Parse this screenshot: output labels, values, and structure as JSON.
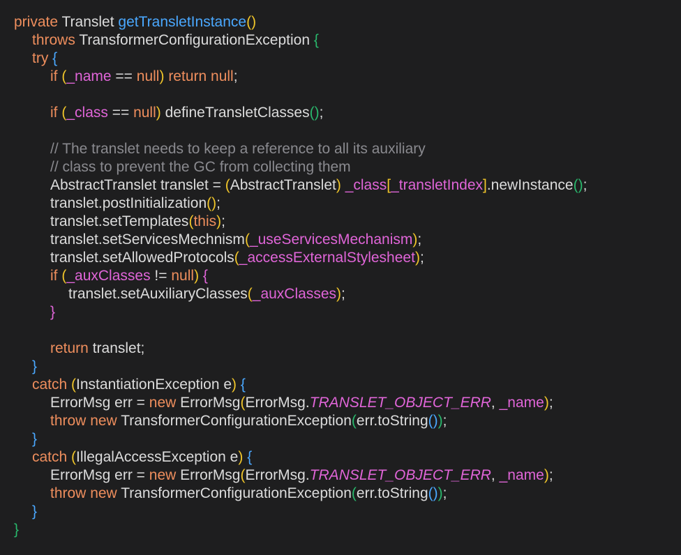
{
  "editor": {
    "theme": {
      "background": "#1e1e1f",
      "text": "#dcdcdc",
      "keyword": "#ee8e5d",
      "function": "#4aa8ff",
      "comment": "#8a8a8f",
      "field": "#e065d8",
      "bracket_yellow": "#f0c52a",
      "bracket_magenta": "#e065d8",
      "bracket_blue": "#4aa8ff",
      "bracket_green": "#29b86c"
    },
    "lines": [
      {
        "indent": 0,
        "tokens": [
          [
            "kw",
            "private"
          ],
          [
            "txt",
            " Translet "
          ],
          [
            "fn",
            "getTransletInstance"
          ],
          [
            "p1",
            "()"
          ]
        ]
      },
      {
        "indent": 1,
        "tokens": [
          [
            "kw",
            "throws"
          ],
          [
            "txt",
            " TransformerConfigurationException "
          ],
          [
            "p4",
            "{"
          ]
        ]
      },
      {
        "indent": 1,
        "tokens": [
          [
            "kw",
            "try"
          ],
          [
            "txt",
            " "
          ],
          [
            "p3",
            "{"
          ]
        ]
      },
      {
        "indent": 2,
        "tokens": [
          [
            "kw",
            "if"
          ],
          [
            "txt",
            " "
          ],
          [
            "p1",
            "("
          ],
          [
            "var",
            "_name"
          ],
          [
            "txt",
            " == "
          ],
          [
            "kw",
            "null"
          ],
          [
            "p1",
            ")"
          ],
          [
            "txt",
            " "
          ],
          [
            "kw",
            "return"
          ],
          [
            "txt",
            " "
          ],
          [
            "kw",
            "null"
          ],
          [
            "txt",
            ";"
          ]
        ]
      },
      {
        "indent": 0,
        "tokens": []
      },
      {
        "indent": 2,
        "tokens": [
          [
            "kw",
            "if"
          ],
          [
            "txt",
            " "
          ],
          [
            "p1",
            "("
          ],
          [
            "var",
            "_class"
          ],
          [
            "txt",
            " == "
          ],
          [
            "kw",
            "null"
          ],
          [
            "p1",
            ")"
          ],
          [
            "txt",
            " defineTransletClasses"
          ],
          [
            "p4",
            "()"
          ],
          [
            "txt",
            ";"
          ]
        ]
      },
      {
        "indent": 0,
        "tokens": []
      },
      {
        "indent": 2,
        "tokens": [
          [
            "comment",
            "// The translet needs to keep a reference to all its auxiliary"
          ]
        ]
      },
      {
        "indent": 2,
        "tokens": [
          [
            "comment",
            "// class to prevent the GC from collecting them"
          ]
        ]
      },
      {
        "indent": 2,
        "tokens": [
          [
            "txt",
            "AbstractTranslet translet = "
          ],
          [
            "p1",
            "("
          ],
          [
            "txt",
            "AbstractTranslet"
          ],
          [
            "p1",
            ")"
          ],
          [
            "txt",
            " "
          ],
          [
            "var",
            "_class"
          ],
          [
            "p1",
            "["
          ],
          [
            "var",
            "_transletIndex"
          ],
          [
            "p1",
            "]"
          ],
          [
            "txt",
            ".newInstance"
          ],
          [
            "p4",
            "()"
          ],
          [
            "txt",
            ";"
          ]
        ]
      },
      {
        "indent": 2,
        "tokens": [
          [
            "txt",
            "translet.postInitialization"
          ],
          [
            "p1",
            "()"
          ],
          [
            "txt",
            ";"
          ]
        ]
      },
      {
        "indent": 2,
        "tokens": [
          [
            "txt",
            "translet.setTemplates"
          ],
          [
            "p1",
            "("
          ],
          [
            "kw",
            "this"
          ],
          [
            "p1",
            ")"
          ],
          [
            "txt",
            ";"
          ]
        ]
      },
      {
        "indent": 2,
        "tokens": [
          [
            "txt",
            "translet.setServicesMechnism"
          ],
          [
            "p1",
            "("
          ],
          [
            "var",
            "_useServicesMechanism"
          ],
          [
            "p1",
            ")"
          ],
          [
            "txt",
            ";"
          ]
        ]
      },
      {
        "indent": 2,
        "tokens": [
          [
            "txt",
            "translet.setAllowedProtocols"
          ],
          [
            "p1",
            "("
          ],
          [
            "var",
            "_accessExternalStylesheet"
          ],
          [
            "p1",
            ")"
          ],
          [
            "txt",
            ";"
          ]
        ]
      },
      {
        "indent": 2,
        "tokens": [
          [
            "kw",
            "if"
          ],
          [
            "txt",
            " "
          ],
          [
            "p1",
            "("
          ],
          [
            "var",
            "_auxClasses"
          ],
          [
            "txt",
            " != "
          ],
          [
            "kw",
            "null"
          ],
          [
            "p1",
            ")"
          ],
          [
            "txt",
            " "
          ],
          [
            "p2",
            "{"
          ]
        ]
      },
      {
        "indent": 3,
        "tokens": [
          [
            "txt",
            "translet.setAuxiliaryClasses"
          ],
          [
            "p1",
            "("
          ],
          [
            "var",
            "_auxClasses"
          ],
          [
            "p1",
            ")"
          ],
          [
            "txt",
            ";"
          ]
        ]
      },
      {
        "indent": 2,
        "tokens": [
          [
            "p2",
            "}"
          ]
        ]
      },
      {
        "indent": 0,
        "tokens": []
      },
      {
        "indent": 2,
        "tokens": [
          [
            "kw",
            "return"
          ],
          [
            "txt",
            " translet;"
          ]
        ]
      },
      {
        "indent": 1,
        "tokens": [
          [
            "p3",
            "}"
          ]
        ]
      },
      {
        "indent": 1,
        "tokens": [
          [
            "kw",
            "catch"
          ],
          [
            "txt",
            " "
          ],
          [
            "p1",
            "("
          ],
          [
            "txt",
            "InstantiationException e"
          ],
          [
            "p1",
            ")"
          ],
          [
            "txt",
            " "
          ],
          [
            "p3",
            "{"
          ]
        ]
      },
      {
        "indent": 2,
        "tokens": [
          [
            "txt",
            "ErrorMsg err = "
          ],
          [
            "kw",
            "new"
          ],
          [
            "txt",
            " ErrorMsg"
          ],
          [
            "p1",
            "("
          ],
          [
            "txt",
            "ErrorMsg."
          ],
          [
            "const",
            "TRANSLET_OBJECT_ERR"
          ],
          [
            "txt",
            ", "
          ],
          [
            "var",
            "_name"
          ],
          [
            "p1",
            ")"
          ],
          [
            "txt",
            ";"
          ]
        ]
      },
      {
        "indent": 2,
        "tokens": [
          [
            "kw",
            "throw"
          ],
          [
            "txt",
            " "
          ],
          [
            "kw",
            "new"
          ],
          [
            "txt",
            " TransformerConfigurationException"
          ],
          [
            "p4",
            "("
          ],
          [
            "txt",
            "err.toString"
          ],
          [
            "p3",
            "()"
          ],
          [
            "p4",
            ")"
          ],
          [
            "txt",
            ";"
          ]
        ]
      },
      {
        "indent": 1,
        "tokens": [
          [
            "p3",
            "}"
          ]
        ]
      },
      {
        "indent": 1,
        "tokens": [
          [
            "kw",
            "catch"
          ],
          [
            "txt",
            " "
          ],
          [
            "p1",
            "("
          ],
          [
            "txt",
            "IllegalAccessException e"
          ],
          [
            "p1",
            ")"
          ],
          [
            "txt",
            " "
          ],
          [
            "p3",
            "{"
          ]
        ]
      },
      {
        "indent": 2,
        "tokens": [
          [
            "txt",
            "ErrorMsg err = "
          ],
          [
            "kw",
            "new"
          ],
          [
            "txt",
            " ErrorMsg"
          ],
          [
            "p1",
            "("
          ],
          [
            "txt",
            "ErrorMsg."
          ],
          [
            "const",
            "TRANSLET_OBJECT_ERR"
          ],
          [
            "txt",
            ", "
          ],
          [
            "var",
            "_name"
          ],
          [
            "p1",
            ")"
          ],
          [
            "txt",
            ";"
          ]
        ]
      },
      {
        "indent": 2,
        "tokens": [
          [
            "kw",
            "throw"
          ],
          [
            "txt",
            " "
          ],
          [
            "kw",
            "new"
          ],
          [
            "txt",
            " TransformerConfigurationException"
          ],
          [
            "p4",
            "("
          ],
          [
            "txt",
            "err.toString"
          ],
          [
            "p3",
            "()"
          ],
          [
            "p4",
            ")"
          ],
          [
            "txt",
            ";"
          ]
        ]
      },
      {
        "indent": 1,
        "tokens": [
          [
            "p3",
            "}"
          ]
        ]
      },
      {
        "indent": 0,
        "tokens": [
          [
            "p4",
            "}"
          ]
        ]
      }
    ]
  }
}
